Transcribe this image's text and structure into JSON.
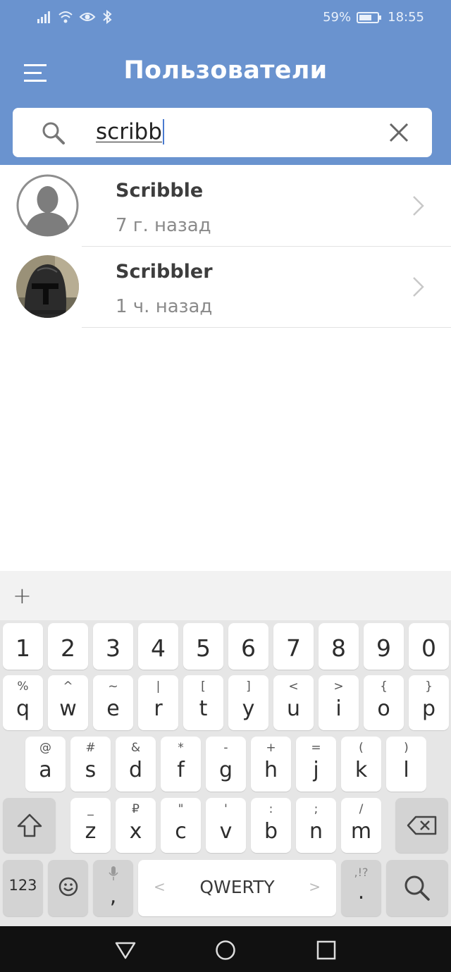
{
  "status_bar": {
    "battery": "59%",
    "time": "18:55",
    "icons": [
      "signal-icon",
      "wifi-icon",
      "eye-icon",
      "bluetooth-icon",
      "battery-icon"
    ]
  },
  "header": {
    "title": "Пользователи",
    "menu_icon": "hamburger-menu-icon"
  },
  "search": {
    "value": "scribb",
    "search_icon": "search-icon",
    "clear_icon": "close-icon"
  },
  "results": [
    {
      "name": "Scribble",
      "time": "7 г. назад",
      "avatar": "default-user-avatar"
    },
    {
      "name": "Scribbler",
      "time": "1 ч. назад",
      "avatar": "helmet-photo-avatar"
    }
  ],
  "keyboard": {
    "toolbar_plus": "+",
    "numbers": [
      "1",
      "2",
      "3",
      "4",
      "5",
      "6",
      "7",
      "8",
      "9",
      "0"
    ],
    "row1": [
      {
        "main": "q",
        "sub": "%"
      },
      {
        "main": "w",
        "sub": "^"
      },
      {
        "main": "e",
        "sub": "~"
      },
      {
        "main": "r",
        "sub": "|"
      },
      {
        "main": "t",
        "sub": "["
      },
      {
        "main": "y",
        "sub": "]"
      },
      {
        "main": "u",
        "sub": "<"
      },
      {
        "main": "i",
        "sub": ">"
      },
      {
        "main": "o",
        "sub": "{"
      },
      {
        "main": "p",
        "sub": "}"
      }
    ],
    "row2": [
      {
        "main": "a",
        "sub": "@"
      },
      {
        "main": "s",
        "sub": "#"
      },
      {
        "main": "d",
        "sub": "&"
      },
      {
        "main": "f",
        "sub": "*"
      },
      {
        "main": "g",
        "sub": "-"
      },
      {
        "main": "h",
        "sub": "+"
      },
      {
        "main": "j",
        "sub": "="
      },
      {
        "main": "k",
        "sub": "("
      },
      {
        "main": "l",
        "sub": ")"
      }
    ],
    "row3": [
      {
        "main": "z",
        "sub": "_"
      },
      {
        "main": "x",
        "sub": "₽"
      },
      {
        "main": "c",
        "sub": "\""
      },
      {
        "main": "v",
        "sub": "'"
      },
      {
        "main": "b",
        "sub": ":"
      },
      {
        "main": "n",
        "sub": ";"
      },
      {
        "main": "m",
        "sub": "/"
      }
    ],
    "mode_key": "123",
    "comma_key": ",",
    "space_label": "QWERTY",
    "period_key": ".",
    "period_sub": ",!?"
  },
  "colors": {
    "header": "#6a93cf",
    "accent_caret": "#4a7bd0"
  }
}
